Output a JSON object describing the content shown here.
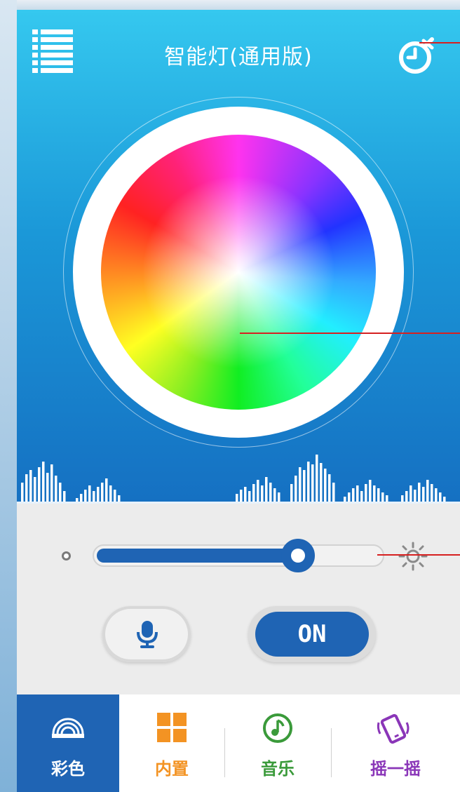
{
  "header": {
    "title": "智能灯(通用版)"
  },
  "color_wheel": {
    "icon": "color-wheel"
  },
  "brightness": {
    "level_percent": 71,
    "min_icon": "dim-dot-icon",
    "max_icon": "sun-icon"
  },
  "controls": {
    "mic_icon": "microphone-icon",
    "power_label": "ON"
  },
  "tabs": [
    {
      "label": "彩色",
      "icon": "rainbow-icon",
      "active": true
    },
    {
      "label": "内置",
      "icon": "grid-icon",
      "active": false
    },
    {
      "label": "音乐",
      "icon": "music-note-icon",
      "active": false
    },
    {
      "label": "摇一摇",
      "icon": "shake-phone-icon",
      "active": false
    }
  ],
  "colors": {
    "accent": "#1f64b4",
    "header_top": "#35c8ef",
    "header_bottom": "#1570c2",
    "builtin": "#f39323",
    "music": "#3a9a3a",
    "shake": "#8a36b8",
    "annotation": "#d62020"
  }
}
